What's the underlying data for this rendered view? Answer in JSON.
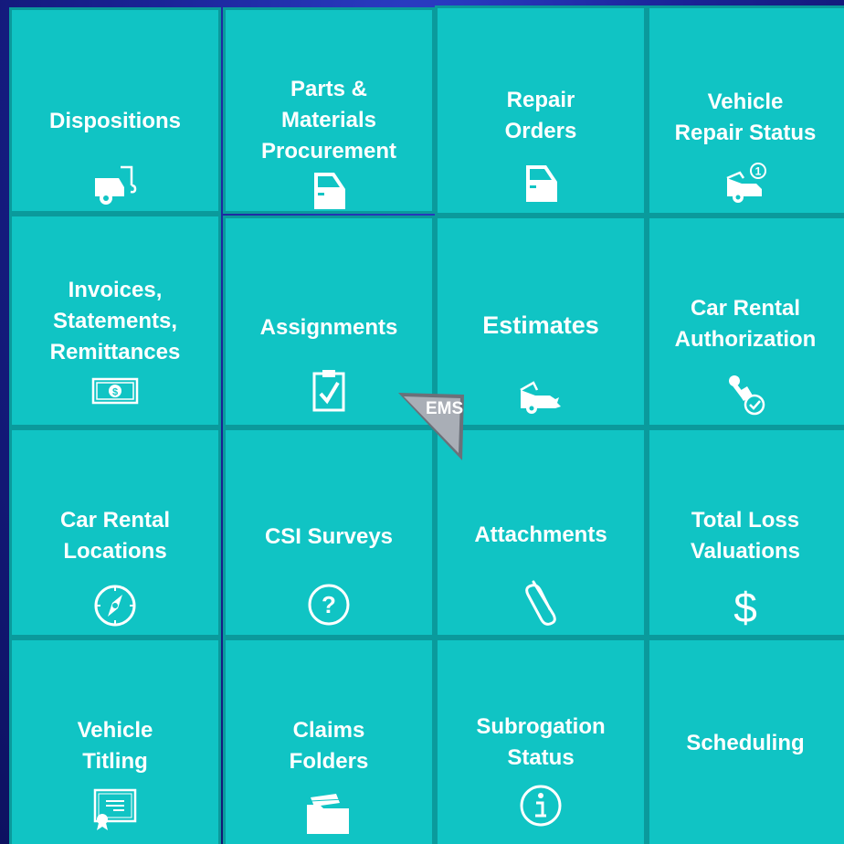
{
  "tiles": {
    "dispositions": "Dispositions",
    "parts": "Parts &\nMaterials\nProcurement",
    "repair_orders": "Repair\nOrders",
    "repair_status": "Vehicle\nRepair Status",
    "invoices": "Invoices,\nStatements,\nRemittances",
    "assignments": "Assignments",
    "estimates": "Estimates",
    "rental_auth": "Car Rental\nAuthorization",
    "rental_locations": "Car Rental\nLocations",
    "csi": "CSI Surveys",
    "attachments": "Attachments",
    "total_loss": "Total Loss\nValuations",
    "titling": "Vehicle\nTitling",
    "claims_folders": "Claims\nFolders",
    "subrogation": "Subrogation\nStatus",
    "scheduling": "Scheduling"
  },
  "ems_label": "EMS",
  "colors": {
    "tile": "#10c4c4",
    "tile_border": "#0a9a9c",
    "background": "#1a2396",
    "text": "#ffffff"
  },
  "icons": {
    "dispositions": "tow-truck-icon",
    "parts": "car-door-icon",
    "repair_orders": "car-door-icon",
    "repair_status": "car-status-icon",
    "invoices": "money-icon",
    "assignments": "clipboard-check-icon",
    "estimates": "car-damage-icon",
    "rental_auth": "stamp-icon",
    "rental_locations": "compass-icon",
    "csi": "question-icon",
    "attachments": "paperclip-icon",
    "total_loss": "dollar-icon",
    "titling": "certificate-icon",
    "claims_folders": "folder-icon",
    "subrogation": "info-icon"
  }
}
